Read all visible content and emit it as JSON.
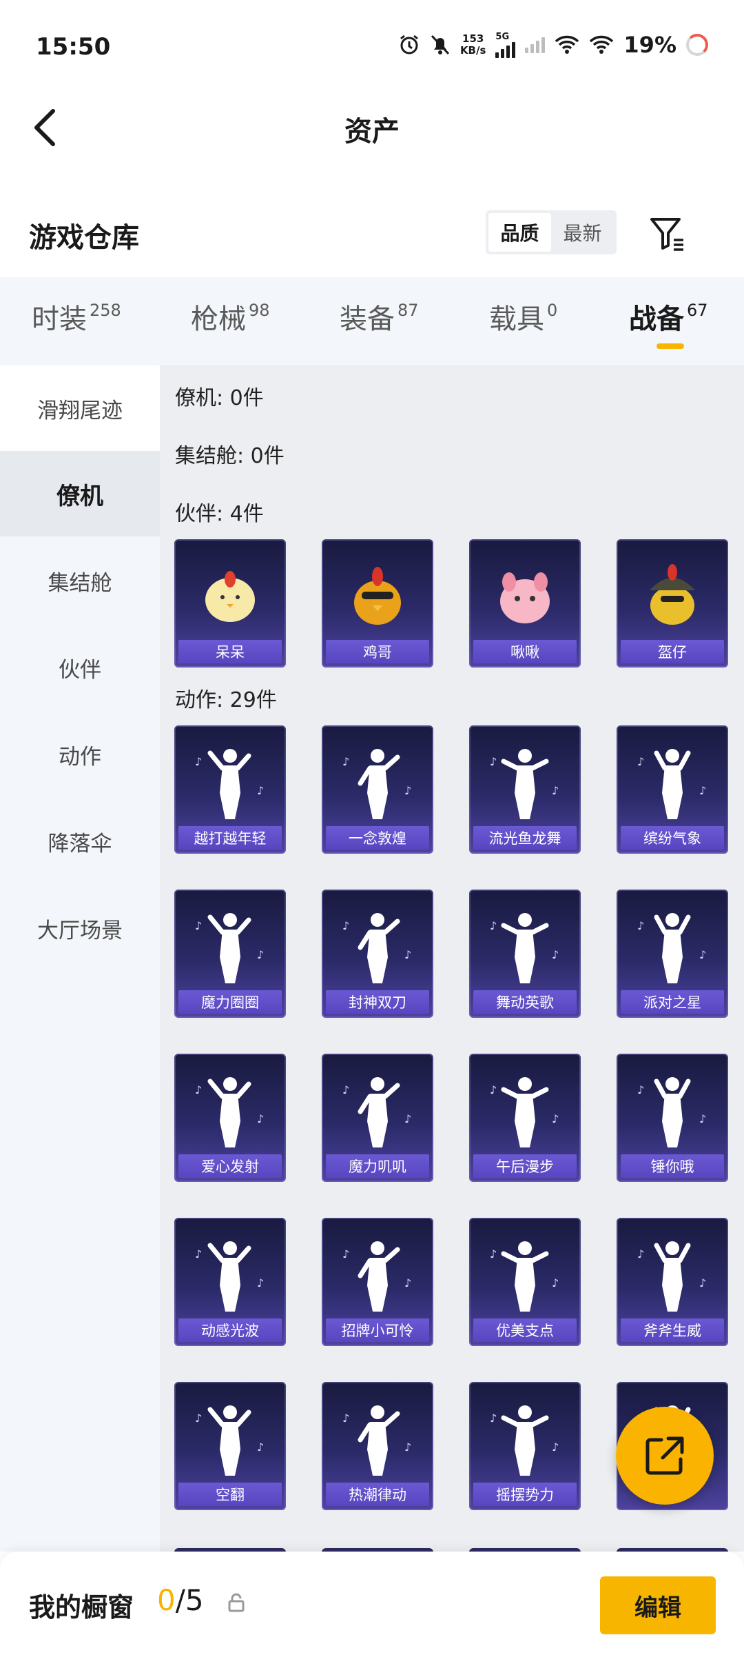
{
  "status_bar": {
    "time": "15:50",
    "net_speed": "153",
    "net_unit": "KB/s",
    "network_type": "5G",
    "battery": "19%"
  },
  "header": {
    "title": "资产"
  },
  "section": {
    "title": "游戏仓库",
    "sort_options": [
      "品质",
      "最新"
    ],
    "sort_selected": "品质"
  },
  "category_tabs": [
    {
      "label": "时装",
      "count": "258"
    },
    {
      "label": "枪械",
      "count": "98"
    },
    {
      "label": "装备",
      "count": "87"
    },
    {
      "label": "载具",
      "count": "0"
    },
    {
      "label": "战备",
      "count": "67",
      "active": true
    }
  ],
  "sidebar": {
    "items": [
      "滑翔尾迹",
      "僚机",
      "集结舱",
      "伙伴",
      "动作",
      "降落伞",
      "大厅场景"
    ],
    "active": "僚机"
  },
  "content": {
    "groups": [
      {
        "header": "僚机: 0件",
        "items": []
      },
      {
        "header": "集结舱: 0件",
        "items": []
      },
      {
        "header": "伙伴: 4件",
        "items": [
          "呆呆",
          "鸡哥",
          "啾啾",
          "盔仔"
        ]
      },
      {
        "header": "动作: 29件",
        "items": [
          "越打越年轻",
          "一念敦煌",
          "流光鱼龙舞",
          "缤纷气象",
          "魔力圈圈",
          "封神双刀",
          "舞动英歌",
          "派对之星",
          "爱心发射",
          "魔力叽叽",
          "午后漫步",
          "锤你哦",
          "动感光波",
          "招牌小可怜",
          "优美支点",
          "斧斧生威",
          "空翻",
          "热潮律动",
          "摇摆势力",
          ""
        ]
      }
    ]
  },
  "bottom_bar": {
    "label": "我的橱窗",
    "count_used": "0",
    "count_total": "/5",
    "edit_label": "编辑"
  },
  "colors": {
    "accent": "#f7b500",
    "card_top": "#191a3f",
    "card_bottom": "#4e43a0",
    "card_label": "#6b59d4",
    "sidebar_bg": "#f3f6fa",
    "content_bg": "#eceef1"
  }
}
